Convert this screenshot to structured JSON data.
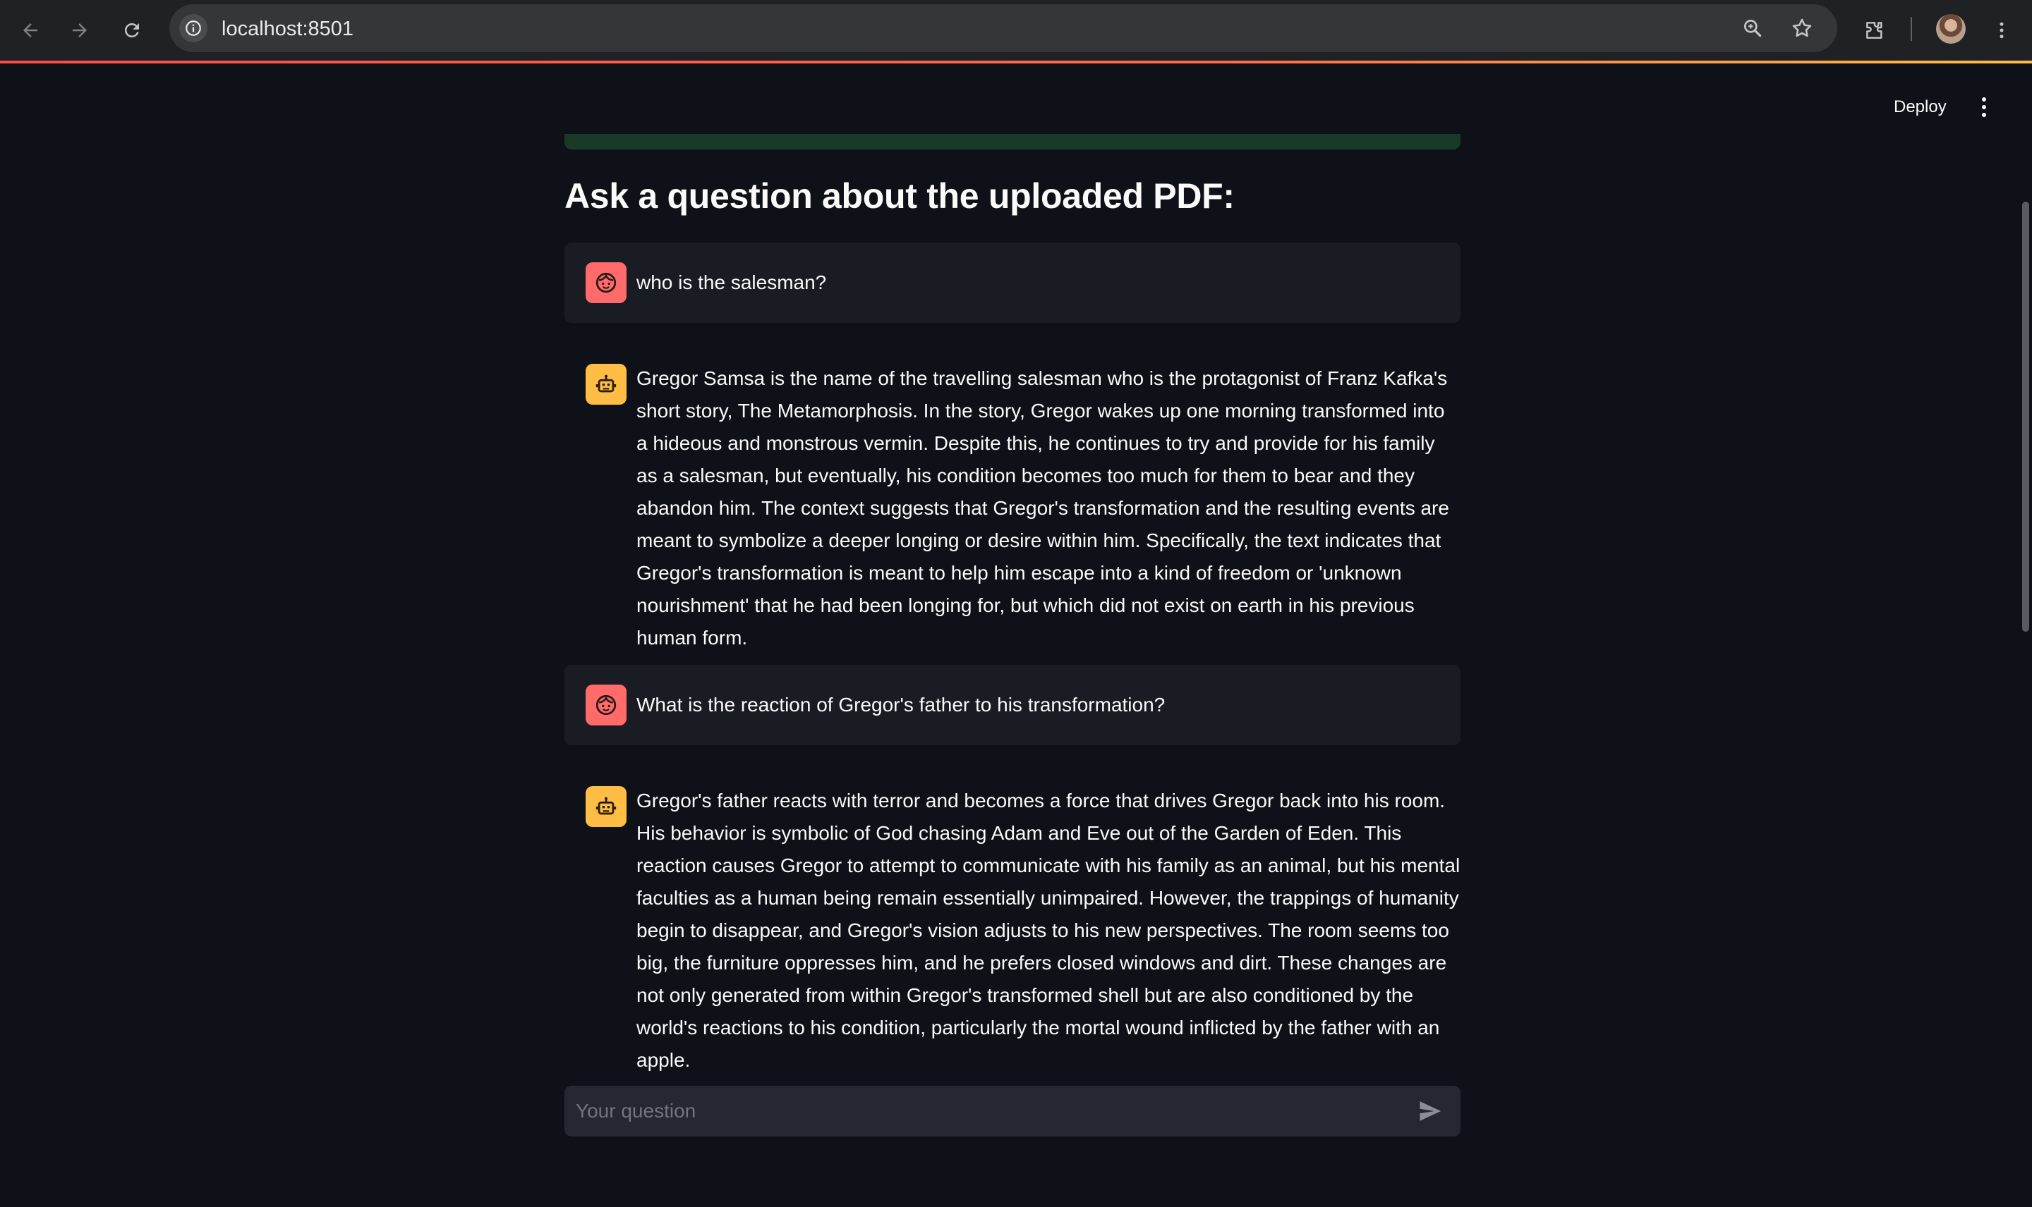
{
  "browser": {
    "url": "localhost:8501",
    "icons": [
      "arrow-left-icon",
      "arrow-right-icon",
      "reload-icon",
      "site-info-icon",
      "zoom-icon",
      "bookmark-star-icon",
      "extensions-icon",
      "profile-avatar",
      "kebab-menu-icon"
    ]
  },
  "app": {
    "header": {
      "deploy_label": "Deploy"
    },
    "heading": "Ask a question about the uploaded PDF:",
    "messages": [
      {
        "role": "user",
        "text": "who is the salesman?"
      },
      {
        "role": "assistant",
        "text": "Gregor Samsa is the name of the travelling salesman who is the protagonist of Franz Kafka's short story, The Metamorphosis. In the story, Gregor wakes up one morning transformed into a hideous and monstrous vermin. Despite this, he continues to try and provide for his family as a salesman, but eventually, his condition becomes too much for them to bear and they abandon him. The context suggests that Gregor's transformation and the resulting events are meant to symbolize a deeper longing or desire within him. Specifically, the text indicates that Gregor's transformation is meant to help him escape into a kind of freedom or 'unknown nourishment' that he had been longing for, but which did not exist on earth in his previous human form."
      },
      {
        "role": "user",
        "text": "What is the reaction of Gregor's father to his transformation?"
      },
      {
        "role": "assistant",
        "text": "Gregor's father reacts with terror and becomes a force that drives Gregor back into his room. His behavior is symbolic of God chasing Adam and Eve out of the Garden of Eden. This reaction causes Gregor to attempt to communicate with his family as an animal, but his mental faculties as a human being remain essentially unimpaired. However, the trappings of humanity begin to disappear, and Gregor's vision adjusts to his new perspectives. The room seems too big, the furniture oppresses him, and he prefers closed windows and dirt. These changes are not only generated from within Gregor's transformed shell but are also conditioned by the world's reactions to his condition, particularly the mortal wound inflicted by the father with an apple."
      }
    ],
    "chat_input": {
      "placeholder": "Your question",
      "value": ""
    },
    "colors": {
      "background": "#0e1117",
      "user_message_bg": "#1a1c24",
      "user_avatar": "#ff6b6b",
      "assistant_avatar": "#ffbd45",
      "input_bg": "#262730",
      "text": "#fafafa"
    }
  }
}
